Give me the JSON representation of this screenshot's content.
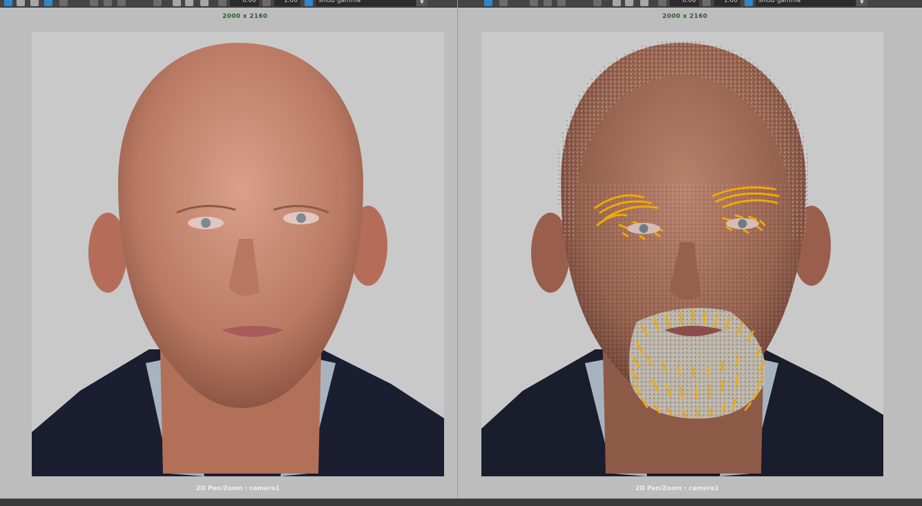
{
  "viewports": [
    {
      "toolbar": {
        "exposure": "0.00",
        "gamma": "1.00",
        "color_space": "sRGB gamma"
      },
      "resolution": "2000 x 2160",
      "camera_label": "2D Pan/Zoom : camera1"
    },
    {
      "toolbar": {
        "exposure": "0.00",
        "gamma": "1.00",
        "color_space": "sRGB gamma"
      },
      "resolution": "2000 x 2160",
      "camera_label": "2D Pan/Zoom : camera1"
    }
  ],
  "colors": {
    "toolbar_bg": "#444444",
    "viewport_bg": "#bdbdbd",
    "render_bg": "#c9c9c9",
    "resolution_text": "#2f5f2f",
    "skin": "#c88b74",
    "shirt": "#1a1d2e",
    "collar": "#a9b6c2",
    "groom_guides": "#f2a900"
  },
  "icons": [
    "render-icon",
    "snapshot-icon",
    "render-region-icon",
    "checker-icon",
    "light-icon",
    "layers-icon",
    "color-wheel-icon",
    "alpha-icon",
    "pixel-icon",
    "exposure-icon",
    "gamma-icon",
    "color-space-icon"
  ]
}
